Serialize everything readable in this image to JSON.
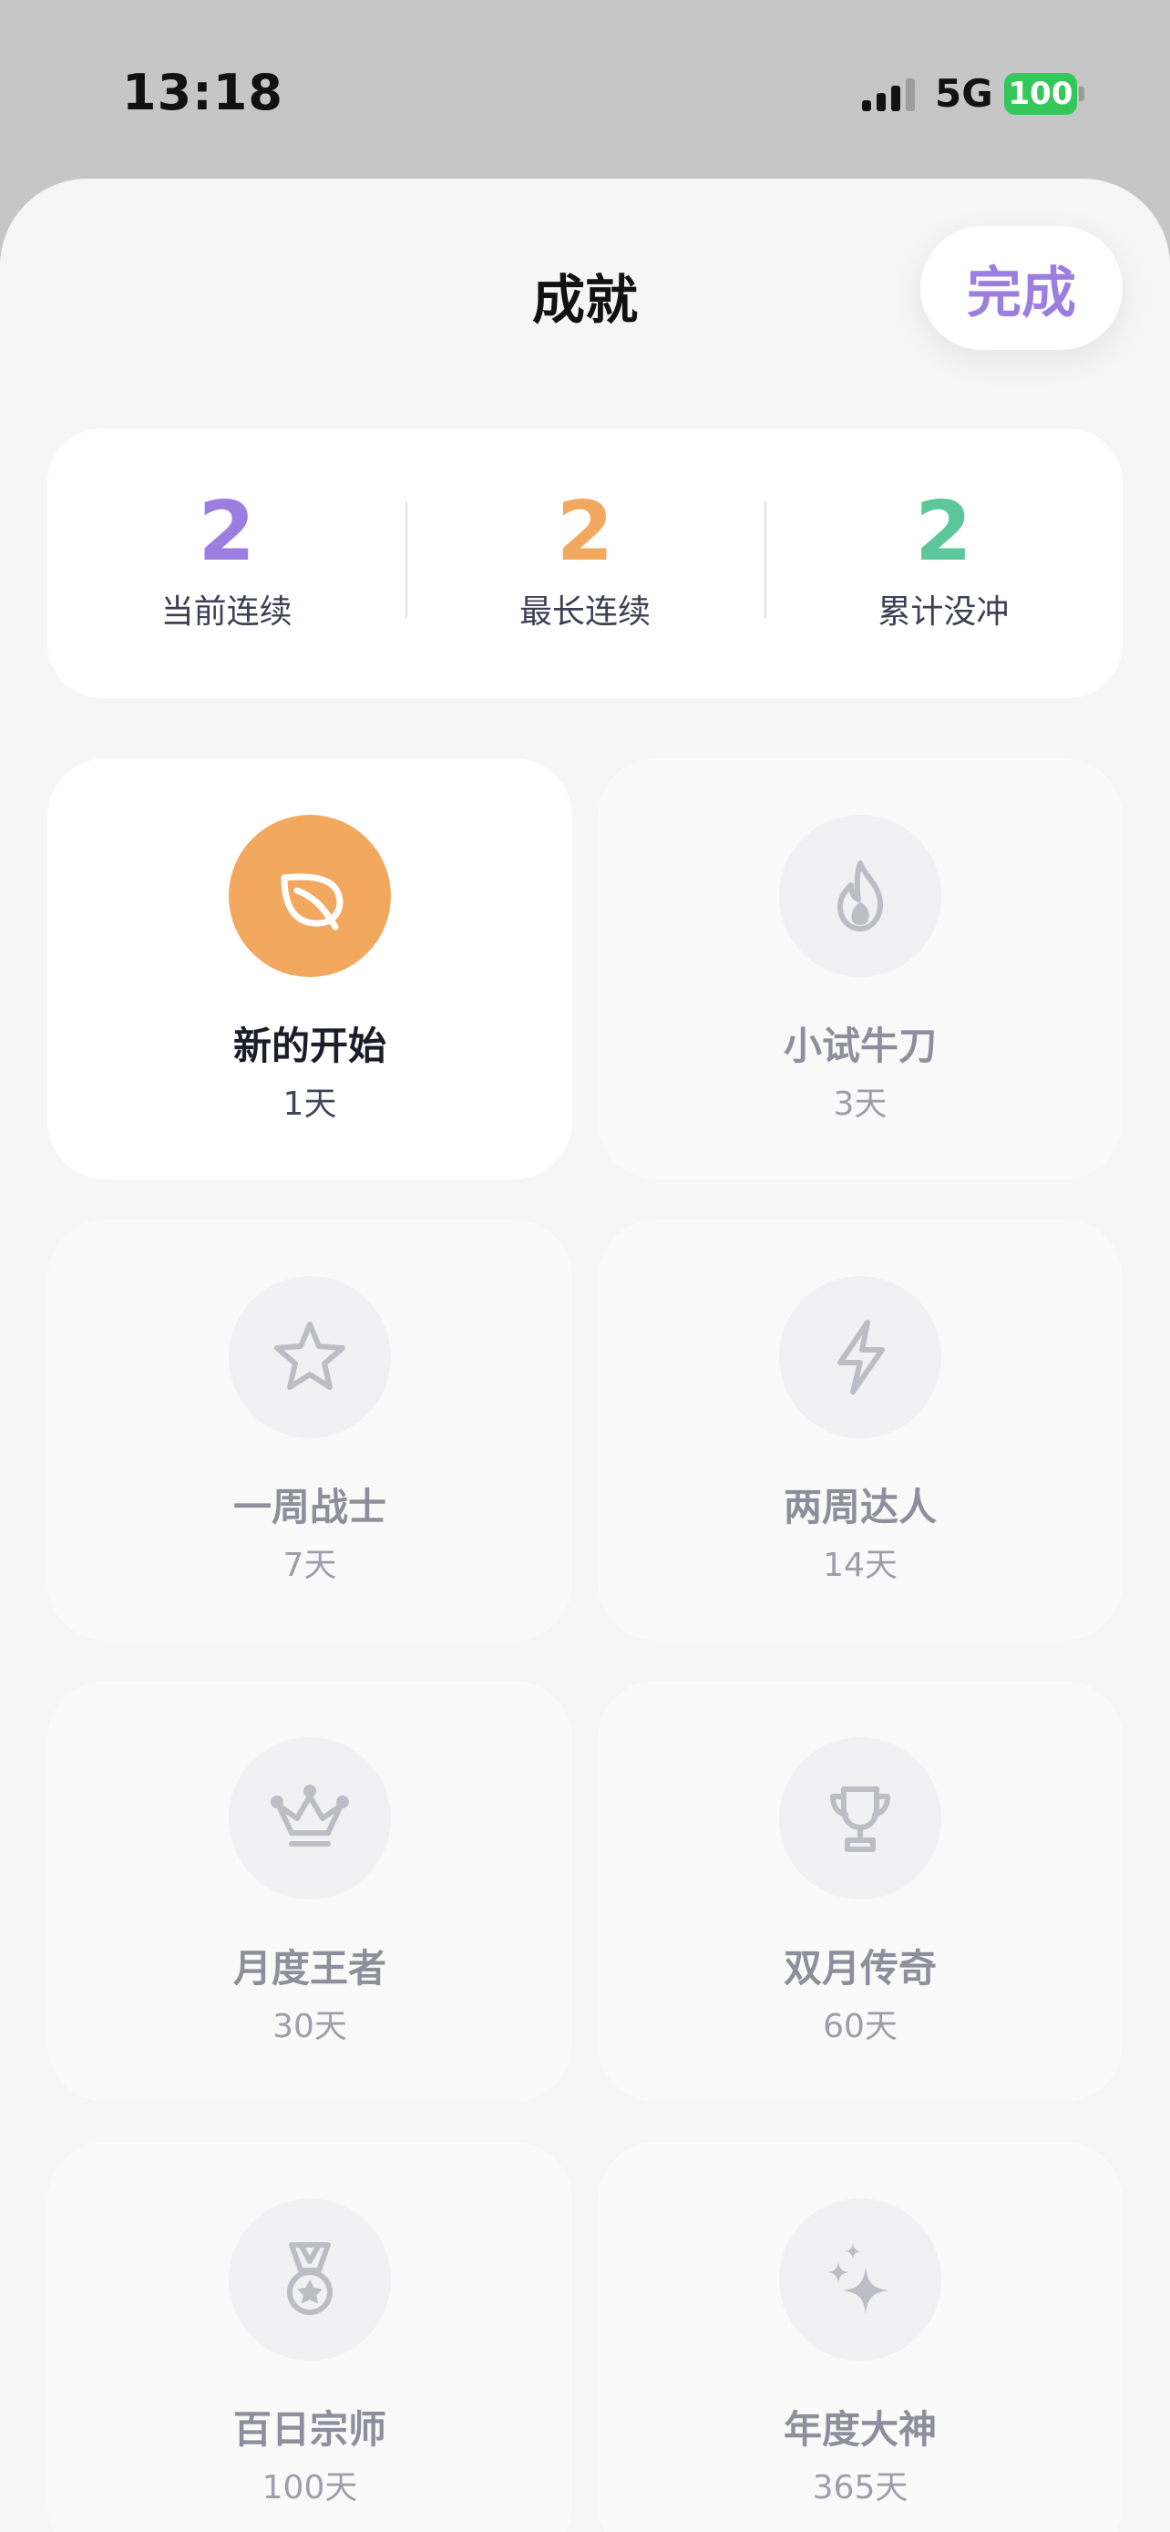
{
  "status_bar": {
    "time": "13:18",
    "network": "5G",
    "battery": "100",
    "battery_color": "#34c759"
  },
  "sheet": {
    "title": "成就",
    "done_label": "完成",
    "accent_color": "#9b7ee0"
  },
  "stats": [
    {
      "value": "2",
      "label": "当前连续",
      "color": "#9b7ee0"
    },
    {
      "value": "2",
      "label": "最长连续",
      "color": "#f2a85f"
    },
    {
      "value": "2",
      "label": "累计没冲",
      "color": "#5cc79b"
    }
  ],
  "badges": [
    {
      "name": "新的开始",
      "days": "1天",
      "icon": "leaf-icon",
      "unlocked": true
    },
    {
      "name": "小试牛刀",
      "days": "3天",
      "icon": "flame-icon",
      "unlocked": false
    },
    {
      "name": "一周战士",
      "days": "7天",
      "icon": "star-icon",
      "unlocked": false
    },
    {
      "name": "两周达人",
      "days": "14天",
      "icon": "lightning-icon",
      "unlocked": false
    },
    {
      "name": "月度王者",
      "days": "30天",
      "icon": "crown-icon",
      "unlocked": false
    },
    {
      "name": "双月传奇",
      "days": "60天",
      "icon": "trophy-icon",
      "unlocked": false
    },
    {
      "name": "百日宗师",
      "days": "100天",
      "icon": "medal-icon",
      "unlocked": false
    },
    {
      "name": "年度大神",
      "days": "365天",
      "icon": "sparkles-icon",
      "unlocked": false
    }
  ]
}
